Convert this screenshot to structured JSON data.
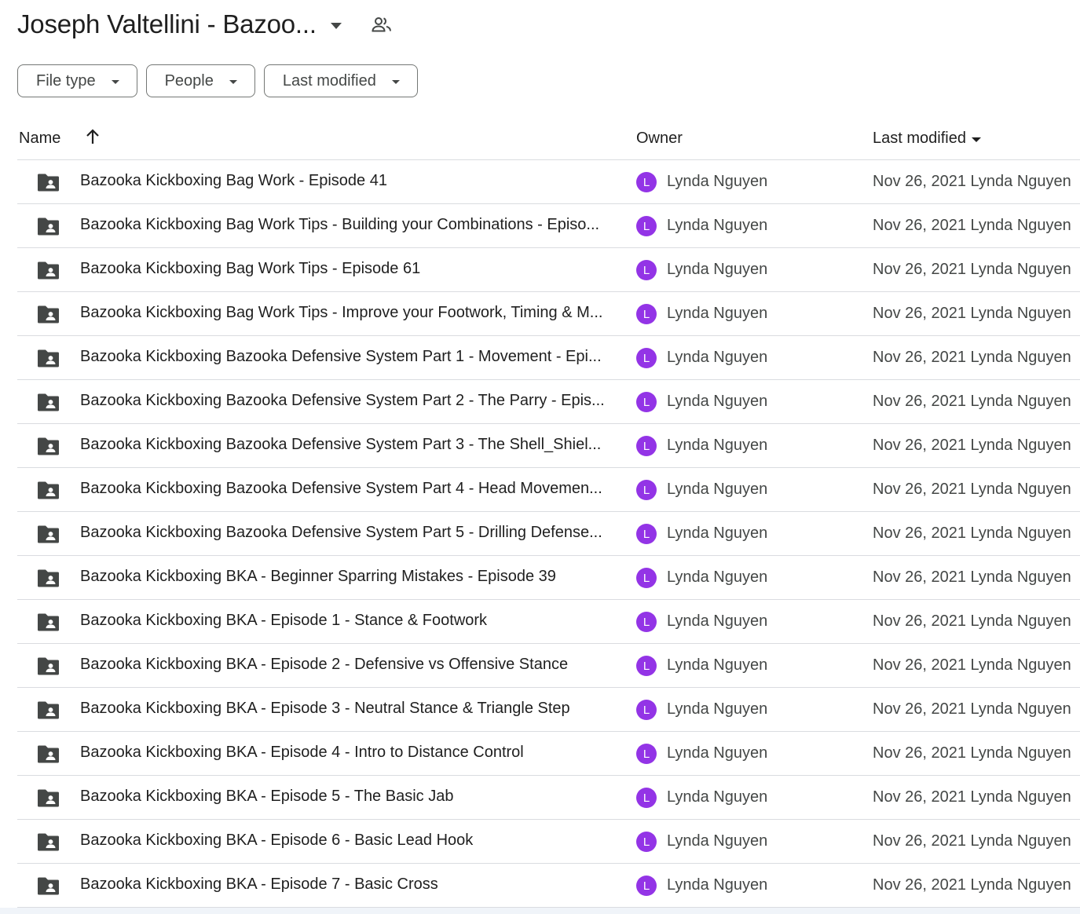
{
  "header": {
    "title": "Joseph Valtellini - Bazoo...",
    "shared_icon": "people-icon"
  },
  "filters": [
    {
      "label": "File type"
    },
    {
      "label": "People"
    },
    {
      "label": "Last modified"
    }
  ],
  "columns": {
    "name": "Name",
    "owner": "Owner",
    "modified": "Last modified",
    "sort_icon": "arrow-up-icon"
  },
  "colors": {
    "avatar": "#9334e6",
    "folder_icon": "#444746",
    "divider": "#dadce0"
  },
  "rows": [
    {
      "name": "Bazooka Kickboxing Bag Work - Episode 41",
      "owner": "Lynda Nguyen",
      "avatar": "L",
      "modified": "Nov 26, 2021 Lynda Nguyen"
    },
    {
      "name": "Bazooka Kickboxing Bag Work Tips - Building your Combinations - Episo...",
      "owner": "Lynda Nguyen",
      "avatar": "L",
      "modified": "Nov 26, 2021 Lynda Nguyen"
    },
    {
      "name": "Bazooka Kickboxing Bag Work Tips - Episode 61",
      "owner": "Lynda Nguyen",
      "avatar": "L",
      "modified": "Nov 26, 2021 Lynda Nguyen"
    },
    {
      "name": "Bazooka Kickboxing Bag Work Tips - Improve your Footwork, Timing & M...",
      "owner": "Lynda Nguyen",
      "avatar": "L",
      "modified": "Nov 26, 2021 Lynda Nguyen"
    },
    {
      "name": "Bazooka Kickboxing Bazooka Defensive System Part 1 - Movement -  Epi...",
      "owner": "Lynda Nguyen",
      "avatar": "L",
      "modified": "Nov 26, 2021 Lynda Nguyen"
    },
    {
      "name": "Bazooka Kickboxing Bazooka Defensive System Part 2 - The Parry - Epis...",
      "owner": "Lynda Nguyen",
      "avatar": "L",
      "modified": "Nov 26, 2021 Lynda Nguyen"
    },
    {
      "name": "Bazooka Kickboxing Bazooka Defensive System Part 3 - The Shell_Shiel...",
      "owner": "Lynda Nguyen",
      "avatar": "L",
      "modified": "Nov 26, 2021 Lynda Nguyen"
    },
    {
      "name": "Bazooka Kickboxing Bazooka Defensive System Part 4 - Head Movemen...",
      "owner": "Lynda Nguyen",
      "avatar": "L",
      "modified": "Nov 26, 2021 Lynda Nguyen"
    },
    {
      "name": "Bazooka Kickboxing Bazooka Defensive System Part 5 - Drilling Defense...",
      "owner": "Lynda Nguyen",
      "avatar": "L",
      "modified": "Nov 26, 2021 Lynda Nguyen"
    },
    {
      "name": "Bazooka Kickboxing BKA - Beginner Sparring Mistakes - Episode 39",
      "owner": "Lynda Nguyen",
      "avatar": "L",
      "modified": "Nov 26, 2021 Lynda Nguyen"
    },
    {
      "name": "Bazooka Kickboxing BKA - Episode 1 - Stance & Footwork",
      "owner": "Lynda Nguyen",
      "avatar": "L",
      "modified": "Nov 26, 2021 Lynda Nguyen"
    },
    {
      "name": "Bazooka Kickboxing BKA - Episode 2 - Defensive vs  Offensive Stance",
      "owner": "Lynda Nguyen",
      "avatar": "L",
      "modified": "Nov 26, 2021 Lynda Nguyen"
    },
    {
      "name": "Bazooka Kickboxing BKA - Episode 3 - Neutral Stance & Triangle Step",
      "owner": "Lynda Nguyen",
      "avatar": "L",
      "modified": "Nov 26, 2021 Lynda Nguyen"
    },
    {
      "name": "Bazooka Kickboxing BKA - Episode 4 - Intro to Distance Control",
      "owner": "Lynda Nguyen",
      "avatar": "L",
      "modified": "Nov 26, 2021 Lynda Nguyen"
    },
    {
      "name": "Bazooka Kickboxing BKA - Episode 5 - The Basic Jab",
      "owner": "Lynda Nguyen",
      "avatar": "L",
      "modified": "Nov 26, 2021 Lynda Nguyen"
    },
    {
      "name": "Bazooka Kickboxing BKA - Episode 6 - Basic Lead Hook",
      "owner": "Lynda Nguyen",
      "avatar": "L",
      "modified": "Nov 26, 2021 Lynda Nguyen"
    },
    {
      "name": "Bazooka Kickboxing BKA - Episode 7 - Basic Cross",
      "owner": "Lynda Nguyen",
      "avatar": "L",
      "modified": "Nov 26, 2021 Lynda Nguyen"
    }
  ]
}
